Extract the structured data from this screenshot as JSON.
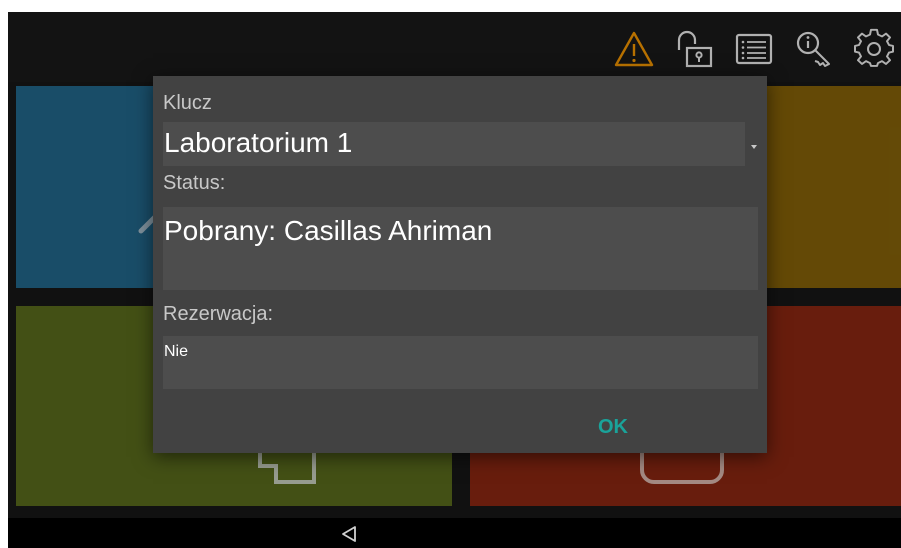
{
  "top_bar": {
    "icons": [
      "warning-icon",
      "unlocked-padlock-icon",
      "list-icon",
      "key-info-icon",
      "gear-icon"
    ],
    "colors": {
      "warning": "#e08a00",
      "icon": "#d8d8d8"
    }
  },
  "tiles": [
    {
      "color": "#1f5f7f"
    },
    {
      "color": "#7a5a08"
    },
    {
      "color": "#52621a"
    },
    {
      "color": "#7f2410"
    }
  ],
  "dialog": {
    "key_label": "Klucz",
    "key_value": "Laboratorium 1",
    "status_label": "Status:",
    "status_value": "Pobrany: Casillas Ahriman",
    "reservation_label": "Rezerwacja:",
    "reservation_value": "Nie",
    "ok_label": "OK",
    "accent": "#1aa39a"
  },
  "nav_bar": {
    "back_icon": "back-triangle-icon"
  }
}
